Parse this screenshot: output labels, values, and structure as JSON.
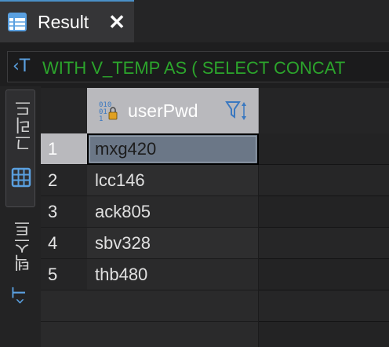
{
  "tab": {
    "title": "Result",
    "close_glyph": "✕",
    "icon": "grid-table-icon"
  },
  "query": {
    "icon": "sql-text-icon",
    "text": "WITH V_TEMP AS ( SELECT CONCAT"
  },
  "side_tabs": [
    {
      "label": "그리드",
      "icon": "grid-icon"
    },
    {
      "label": "텍스트",
      "icon": "text-icon"
    }
  ],
  "grid": {
    "column": {
      "label": "userPwd",
      "type_icon": "binary-lock-icon",
      "filter_icon": "filter-sort-icon"
    },
    "rows": [
      {
        "num": "1",
        "value": "mxg420"
      },
      {
        "num": "2",
        "value": "lcc146"
      },
      {
        "num": "3",
        "value": "ack805"
      },
      {
        "num": "4",
        "value": "sbv328"
      },
      {
        "num": "5",
        "value": "thb480"
      }
    ],
    "selected_row": 1
  },
  "colors": {
    "accent": "#4a90c8",
    "sql_text": "#2ca52c",
    "header_bg": "#b9b9bd",
    "selected_cell": "#6b7787"
  }
}
